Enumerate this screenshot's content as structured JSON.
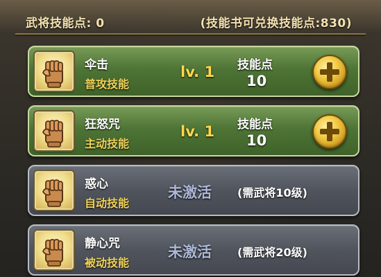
{
  "header": {
    "skill_points": "武将技能点: 0",
    "exchangeable_points": "(技能书可兑换技能点:830)"
  },
  "skills": [
    {
      "name": "伞击",
      "type": "普攻技能",
      "level": "lv. 1",
      "points_label": "技能点",
      "points_value": "10",
      "icon": "fist-icon",
      "action_icon": "plus-icon"
    },
    {
      "name": "狂怒咒",
      "type": "主动技能",
      "level": "lv. 1",
      "points_label": "技能点",
      "points_value": "10",
      "icon": "fist-icon",
      "action_icon": "plus-icon"
    },
    {
      "name": "惑心",
      "type": "自动技能",
      "status": "未激活",
      "requirement": "(需武将10级)",
      "icon": "fist-icon"
    },
    {
      "name": "静心咒",
      "type": "被动技能",
      "status": "未激活",
      "requirement": "(需武将20级)",
      "icon": "fist-icon"
    }
  ],
  "colors": {
    "active_card": "#4e7436",
    "inactive_card": "#50545c",
    "skill_type": "#f1d35a",
    "level": "#ffd84a",
    "inactive_status": "#aeb8d8",
    "plus_button": "#f2c842"
  }
}
